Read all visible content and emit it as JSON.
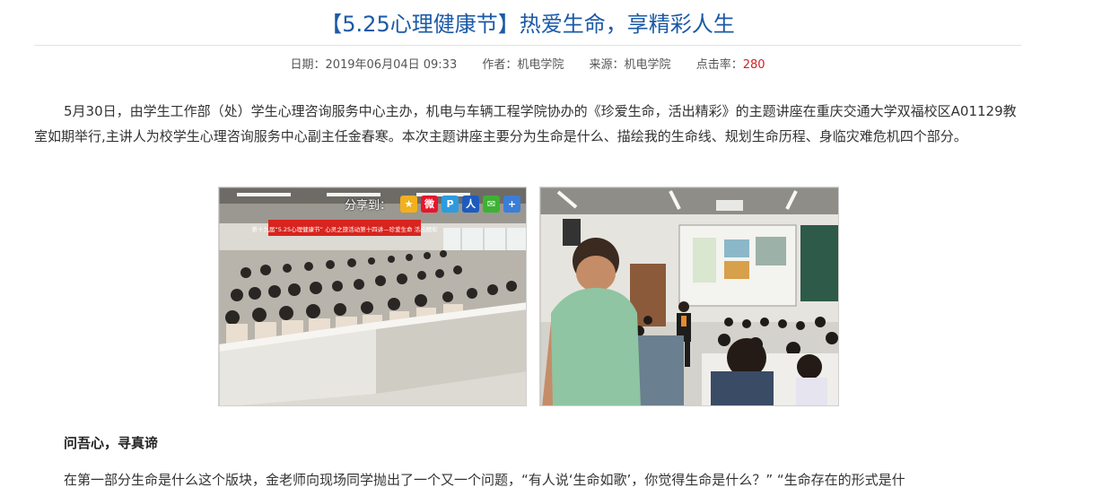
{
  "article": {
    "title": "【5.25心理健康节】热爱生命，享精彩人生",
    "meta": {
      "date_label": "日期：",
      "date_value": "2019年06月04日 09:33",
      "author_label": "作者：",
      "author_value": "机电学院",
      "source_label": "来源：",
      "source_value": "机电学院",
      "hits_label": "点击率：",
      "hits_value": "280"
    },
    "paragraph_1": "5月30日，由学生工作部（处）学生心理咨询服务中心主办，机电与车辆工程学院协办的《珍爱生命，活出精彩》的主题讲座在重庆交通大学双福校区A01129教室如期举行,主讲人为校学生心理咨询服务中心副主任金春寒。本次主题讲座主要分为生命是什么、描绘我的生命线、规划生命历程、身临灾难危机四个部分。",
    "share": {
      "label": "分享到：",
      "buttons": [
        {
          "icon": "qzone-icon",
          "glyph": "★",
          "color": "#f2b01e"
        },
        {
          "icon": "weibo-icon",
          "glyph": "微",
          "color": "#e6162d"
        },
        {
          "icon": "pengyou-icon",
          "glyph": "P",
          "color": "#2d9be0"
        },
        {
          "icon": "renren-icon",
          "glyph": "人",
          "color": "#1f5bbd"
        },
        {
          "icon": "wechat-icon",
          "glyph": "✉",
          "color": "#3eb135"
        },
        {
          "icon": "more-icon",
          "glyph": "+",
          "color": "#3b7ed8"
        }
      ]
    },
    "photo_banner_text": "第十九届“5.25心理健康节” 心灵之旅活动第十四讲—珍爱生命 活出精彩",
    "subheading": "问吾心，寻真谛",
    "paragraph_2": "在第一部分生命是什么这个版块，金老师向现场同学抛出了一个又一个问题，“有人说‘生命如歌’，你觉得生命是什么？” “生命存在的形式是什"
  },
  "colors": {
    "title": "#1b5aa8",
    "hits": "#d42020",
    "text": "#333333"
  }
}
